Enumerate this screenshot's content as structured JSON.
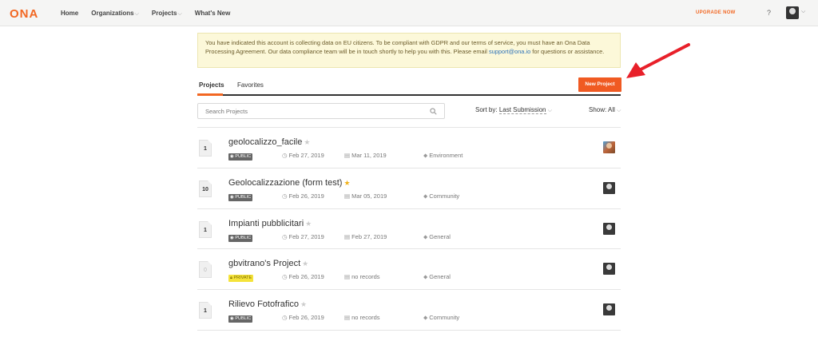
{
  "header": {
    "logo": "ONA",
    "nav": [
      {
        "label": "Home"
      },
      {
        "label": "Organizations",
        "caret": "⌵"
      },
      {
        "label": "Projects",
        "caret": "⌵"
      },
      {
        "label": "What's New"
      }
    ],
    "upgrade": "UPGRADE NOW",
    "help": "?"
  },
  "banner": {
    "text": "You have indicated this account is collecting data on EU citizens. To be compliant with GDPR and our terms of service, you must have an Ona Data Processing Agreement. Our data compliance team will be in touch shortly to help you with this. Please email ",
    "link": "support@ona.io",
    "text_after": " for questions or assistance."
  },
  "tabs": [
    {
      "label": "Projects",
      "active": true
    },
    {
      "label": "Favorites",
      "active": false
    }
  ],
  "new_project_label": "New Project",
  "search": {
    "placeholder": "Search Projects"
  },
  "sort": {
    "label": "Sort by:",
    "value": "Last Submission"
  },
  "show": {
    "label": "Show:",
    "value": "All"
  },
  "projects": [
    {
      "count": "1",
      "name": "geolocalizzo_facile",
      "starred": false,
      "visibility": "PUBLIC",
      "created": "Feb 27, 2019",
      "updated": "Mar 11, 2019",
      "tag": "Environment",
      "avatar": "color"
    },
    {
      "count": "10",
      "name": "Geolocalizzazione (form test)",
      "starred": true,
      "visibility": "PUBLIC",
      "created": "Feb 26, 2019",
      "updated": "Mar 05, 2019",
      "tag": "Community",
      "avatar": "bw"
    },
    {
      "count": "1",
      "name": "Impianti pubblicitari",
      "starred": false,
      "visibility": "PUBLIC",
      "created": "Feb 27, 2019",
      "updated": "Feb 27, 2019",
      "tag": "General",
      "avatar": "bw"
    },
    {
      "count": "0",
      "name": "gbvitrano's Project",
      "starred": false,
      "visibility": "PRIVATE",
      "created": "Feb 26, 2019",
      "updated": "no records",
      "tag": "General",
      "avatar": "bw"
    },
    {
      "count": "1",
      "name": "Rilievo Fotofrafico",
      "starred": false,
      "visibility": "PUBLIC",
      "created": "Feb 26, 2019",
      "updated": "no records",
      "tag": "Community",
      "avatar": "bw"
    }
  ],
  "colors": {
    "accent": "#f26722",
    "button": "#f05a22",
    "banner_bg": "#fcf8d9",
    "arrow": "#e8202a",
    "star_on": "#f2b21a"
  }
}
